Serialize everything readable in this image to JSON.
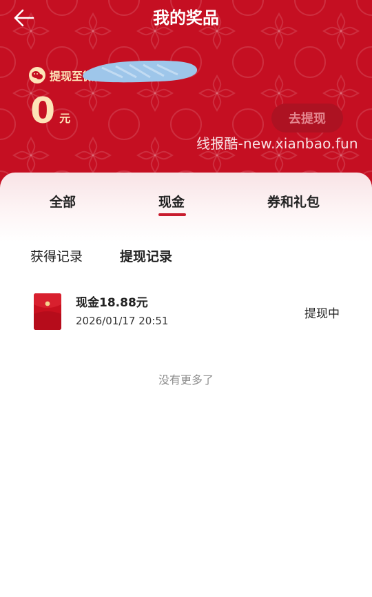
{
  "header": {
    "title": "我的奖品",
    "back_icon": "arrow-left-icon",
    "withdraw_to_label": "提现至微信",
    "amount": "0",
    "amount_unit": "元",
    "withdraw_button": "去提现",
    "watermark": "线报酷-new.xianbao.fun"
  },
  "tabs": [
    {
      "label": "全部",
      "selected": false
    },
    {
      "label": "现金",
      "selected": true
    },
    {
      "label": "券和礼包",
      "selected": false
    }
  ],
  "subtabs": [
    {
      "label": "获得记录",
      "selected": false
    },
    {
      "label": "提现记录",
      "selected": true
    }
  ],
  "records": [
    {
      "title": "现金18.88元",
      "time": "2026/01/17 20:51",
      "status": "提现中"
    }
  ],
  "footer": {
    "no_more": "没有更多了"
  },
  "colors": {
    "header_red": "#c50f22",
    "gold_text": "#fde4b8",
    "tab_underline": "#c81c2e",
    "button_bg": "#ad1222",
    "button_text": "#e4868f"
  }
}
